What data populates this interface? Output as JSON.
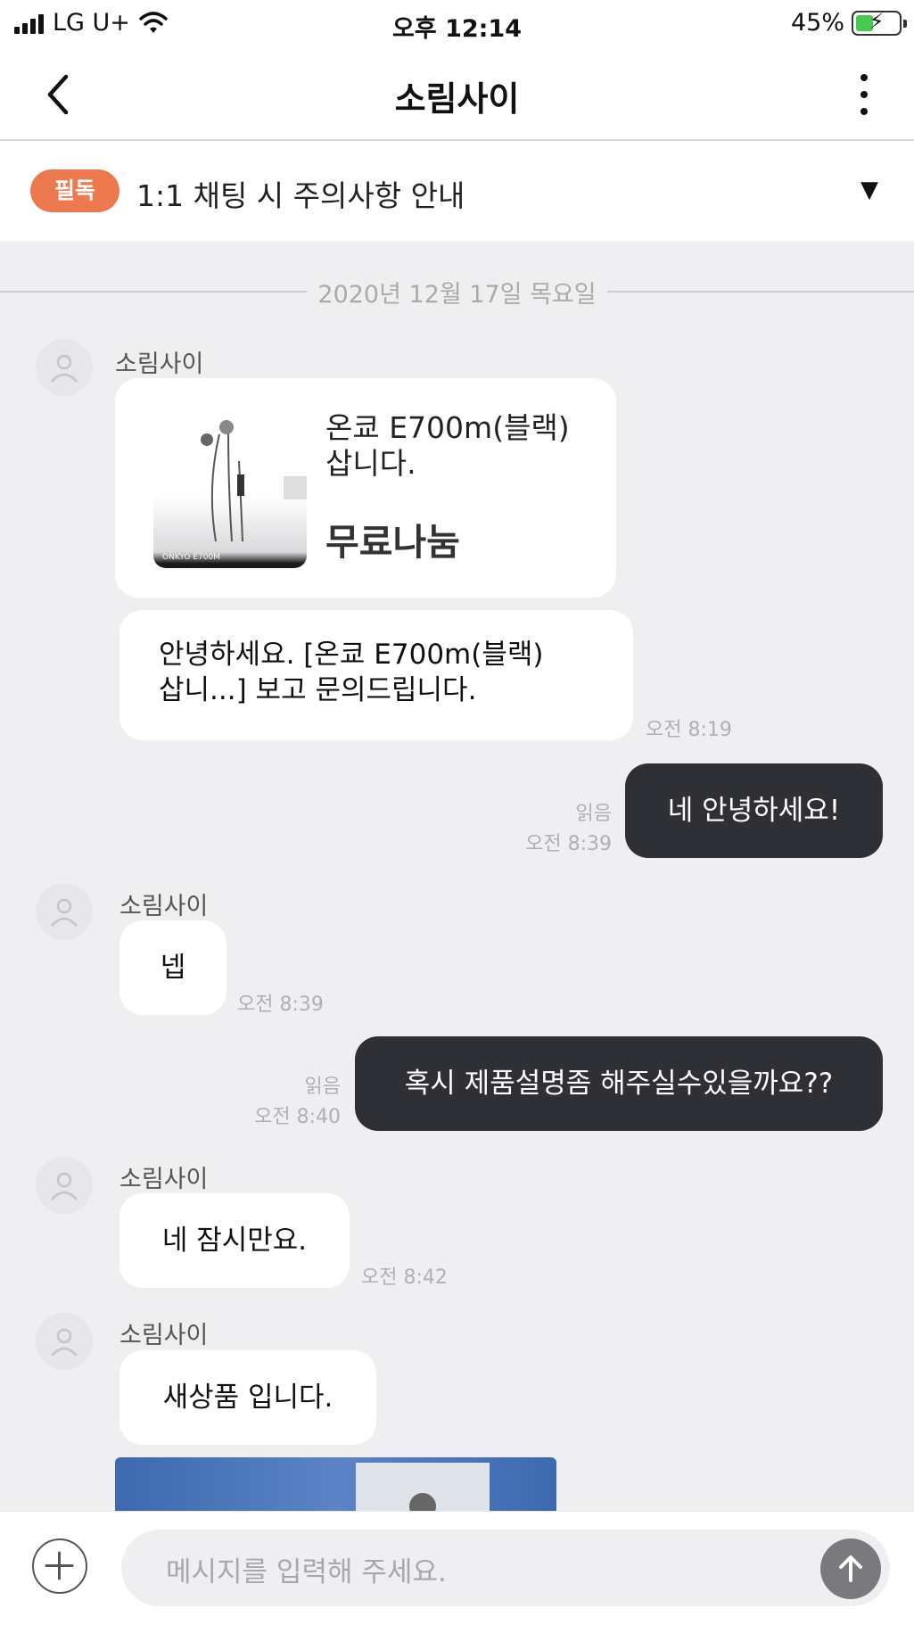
{
  "status_bar": {
    "carrier": "LG U+",
    "time": "오후 12:14",
    "battery_percent": "45%",
    "battery_level": 0.45,
    "icons": [
      "signal-icon",
      "wifi-icon",
      "battery-icon",
      "charging-bolt-icon"
    ]
  },
  "nav": {
    "title": "소림사이",
    "back_icon": "chevron-left-icon",
    "more_icon": "more-vertical-icon"
  },
  "notice": {
    "badge": "필독",
    "text": "1:1 채팅 시 주의사항 안내",
    "arrow": "▼"
  },
  "chat": {
    "date": "2020년 12월 17일 목요일",
    "product": {
      "sender": "소림사이",
      "name": "온쿄 E700m(블랙) 삽니다.",
      "price": "무료나눔"
    },
    "messages": [
      {
        "direction": "in",
        "text_line1": "안녕하세요. [온쿄 E700m(블랙)",
        "text_line2": "삽니...] 보고 문의드립니다.",
        "time": "오전 8:19"
      },
      {
        "direction": "out",
        "text": "네 안녕하세요!",
        "read": "읽음",
        "time": "오전 8:39"
      },
      {
        "direction": "in",
        "sender": "소림사이",
        "text": "넵",
        "time": "오전 8:39"
      },
      {
        "direction": "out",
        "text": "혹시 제품설명좀 해주실수있을까요??",
        "read": "읽음",
        "time": "오전 8:40"
      },
      {
        "direction": "in",
        "sender": "소림사이",
        "text": "네 잠시만요.",
        "time": "오전 8:42"
      },
      {
        "direction": "in",
        "sender": "소림사이",
        "text": "새상품 입니다."
      }
    ]
  },
  "input_bar": {
    "placeholder": "메시지를 입력해 주세요.",
    "plus_icon": "plus-icon",
    "send_icon": "arrow-up-icon"
  },
  "colors": {
    "accent_badge": "#ec7a4e",
    "outgoing_bubble": "#2e3036",
    "background": "#efeff1"
  }
}
